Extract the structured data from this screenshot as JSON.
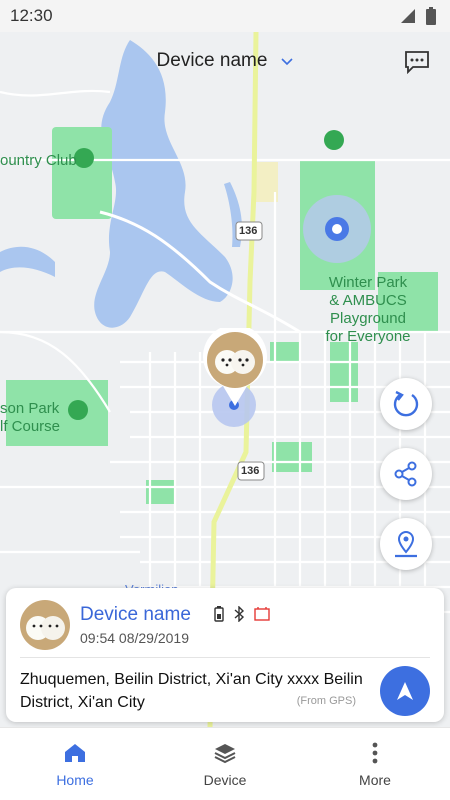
{
  "status_bar": {
    "time": "12:30"
  },
  "header": {
    "device_name": "Device name"
  },
  "map": {
    "labels": {
      "country_club": "ountry Club",
      "park": "Winter Park\n& AMBUCS\nPlayground\nfor Everyone",
      "golf": "son Park\nlf Course",
      "road_1": "136",
      "road_2": "136",
      "bottom_cut": "Vermilion"
    }
  },
  "device_card": {
    "name": "Device name",
    "time": "09:54 08/29/2019",
    "address": "Zhuquemen, Beilin District, Xi'an City xxxx Beilin District, Xi'an City",
    "source": "(From GPS)"
  },
  "bottom_nav": {
    "items": [
      {
        "label": "Home",
        "icon": "home-icon"
      },
      {
        "label": "Device",
        "icon": "layers-icon"
      },
      {
        "label": "More",
        "icon": "more-vertical-icon"
      }
    ]
  },
  "colors": {
    "accent": "#3d6fe0",
    "water": "#aac6ef",
    "park": "#8fe3a8",
    "road": "#ffffff",
    "highway": "#eaf39b"
  }
}
